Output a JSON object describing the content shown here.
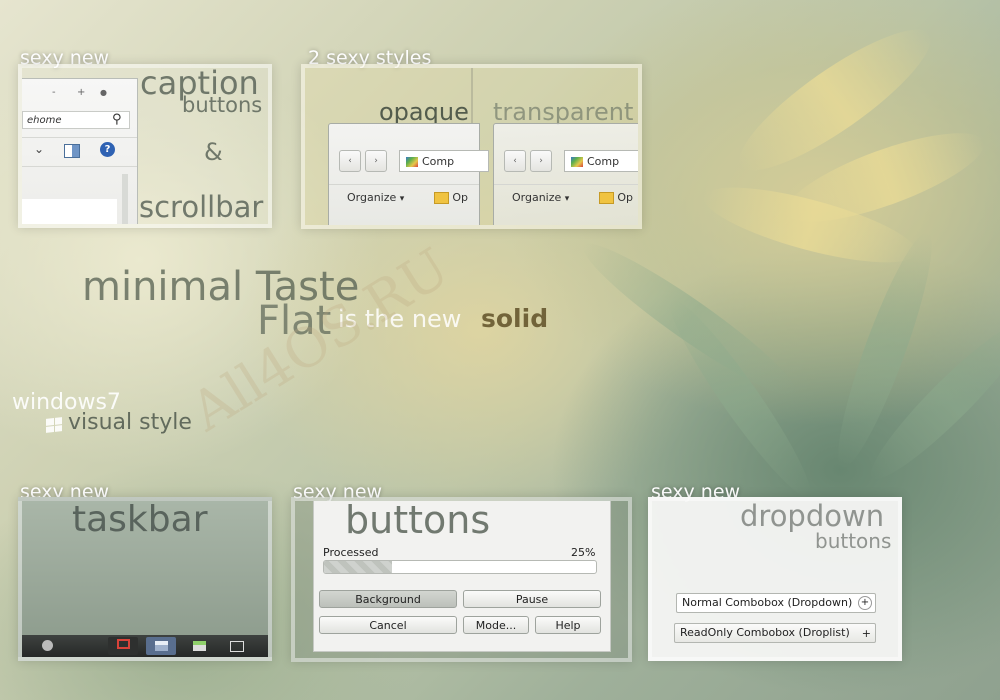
{
  "sections": {
    "caption": {
      "label": "sexy new",
      "word1": "caption",
      "word2": "buttons",
      "amp": "&",
      "word3": "scrollbar",
      "window": {
        "min_glyph": "-",
        "max_glyph": "+",
        "close_glyph": "●",
        "address_text": "ehome",
        "search_glyph": "⚲",
        "chevron_glyph": "⌄",
        "help_glyph": "?"
      }
    },
    "styles": {
      "label": "2 sexy styles",
      "opaque": "opaque",
      "transparent": "transparent",
      "back_glyph": "‹",
      "forward_glyph": "›",
      "breadcrumb_text": "Comp",
      "organize_label": "Organize",
      "open_label": "Op"
    },
    "taskbar": {
      "label": "sexy new",
      "word": "taskbar"
    },
    "buttons": {
      "label": "sexy new",
      "word": "buttons",
      "progress_label": "Processed",
      "progress_percent_text": "25%",
      "progress_value": 0.25,
      "btn_background": "Background",
      "btn_pause": "Pause",
      "btn_cancel": "Cancel",
      "btn_mode": "Mode...",
      "btn_help": "Help"
    },
    "dropdown": {
      "label": "sexy new",
      "word1": "dropdown",
      "word2": "buttons",
      "combo1": "Normal Combobox (Dropdown)",
      "combo2": "ReadOnly Combobox (Droplist)",
      "plus_glyph": "+"
    }
  },
  "headline": {
    "line1": "minimal Taste",
    "line2_flat": "Flat",
    "line2_mid": "is the new",
    "line2_solid": "solid"
  },
  "watermark": "All4OS.RU",
  "visual_style": {
    "line1": "windows7",
    "line2": "visual style"
  },
  "colors": {
    "gmail_red": "#d9433a",
    "progress_fill": "#c9ccc8"
  }
}
